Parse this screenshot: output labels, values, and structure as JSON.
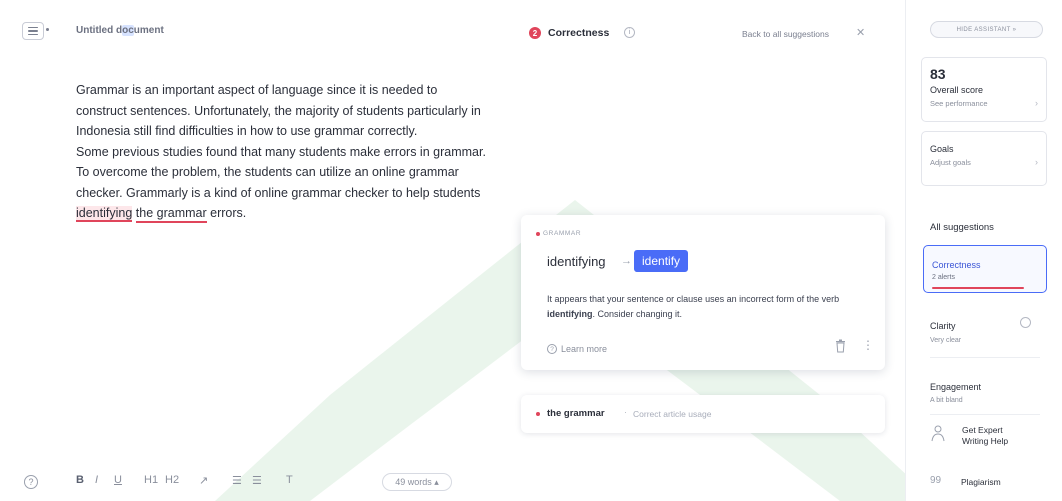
{
  "editor": {
    "title_before": "Untitled d",
    "title_selected": "oc",
    "title_after": "ument",
    "paragraph1": "Grammar is an important aspect of language since it is needed to construct sentences. Unfortunately, the majority of students particularly in Indonesia still find difficulties in how to use grammar correctly.",
    "paragraph2_before": "Some previous studies found that many students make errors in grammar. To overcome the problem, the students can utilize an online grammar checker. Grammarly is a kind of online grammar checker to help students ",
    "paragraph2_err1": "identifying",
    "paragraph2_mid": " ",
    "paragraph2_err2": "the grammar",
    "paragraph2_after": " errors."
  },
  "toolbar": {
    "help": "?",
    "bold": "B",
    "italic": "I",
    "underline": "U",
    "h1": "H1",
    "h2": "H2",
    "link": "↗",
    "ol": "☰",
    "ul": "☰",
    "clear": "T",
    "word_count": "49 words ▴"
  },
  "panel": {
    "icon_count": "2",
    "title": "Correctness",
    "info": "i",
    "back_link": "Back to all suggestions",
    "close": "✕"
  },
  "suggestion_card": {
    "category": "Grammar",
    "original": "identifying",
    "arrow": "→",
    "replacement": "identify",
    "message_before": "It appears that your sentence or clause uses an incorrect form of the verb ",
    "message_bold": "identifying",
    "message_after": ". Consider changing it.",
    "learn_icon": "?",
    "learn_more": "Learn more",
    "more": "⋮"
  },
  "suggestion_card2": {
    "title": "the grammar",
    "separator": "·",
    "description": "Correct article usage"
  },
  "sidebar": {
    "hide_button": "HIDE ASSISTANT »",
    "score_value": "83",
    "score_label": "Overall score",
    "score_sub": "See performance",
    "goals_label": "Goals",
    "goals_sub": "Adjust goals",
    "chevron": "›",
    "all_suggestions": "All suggestions",
    "correctness_label": "Correctness",
    "correctness_sub": "2 alerts",
    "clarity_label": "Clarity",
    "clarity_sub": "Very clear",
    "engagement_label": "Engagement",
    "engagement_sub": "A bit bland",
    "expert_line1": "Get Expert",
    "expert_line2": "Writing Help",
    "plagiarism_icon": "99",
    "plagiarism_label": "Plagiarism"
  },
  "colors": {
    "accent_blue": "#4a6cf7",
    "error_red": "#e0455b",
    "watermark_green": "#e3f2e6"
  }
}
